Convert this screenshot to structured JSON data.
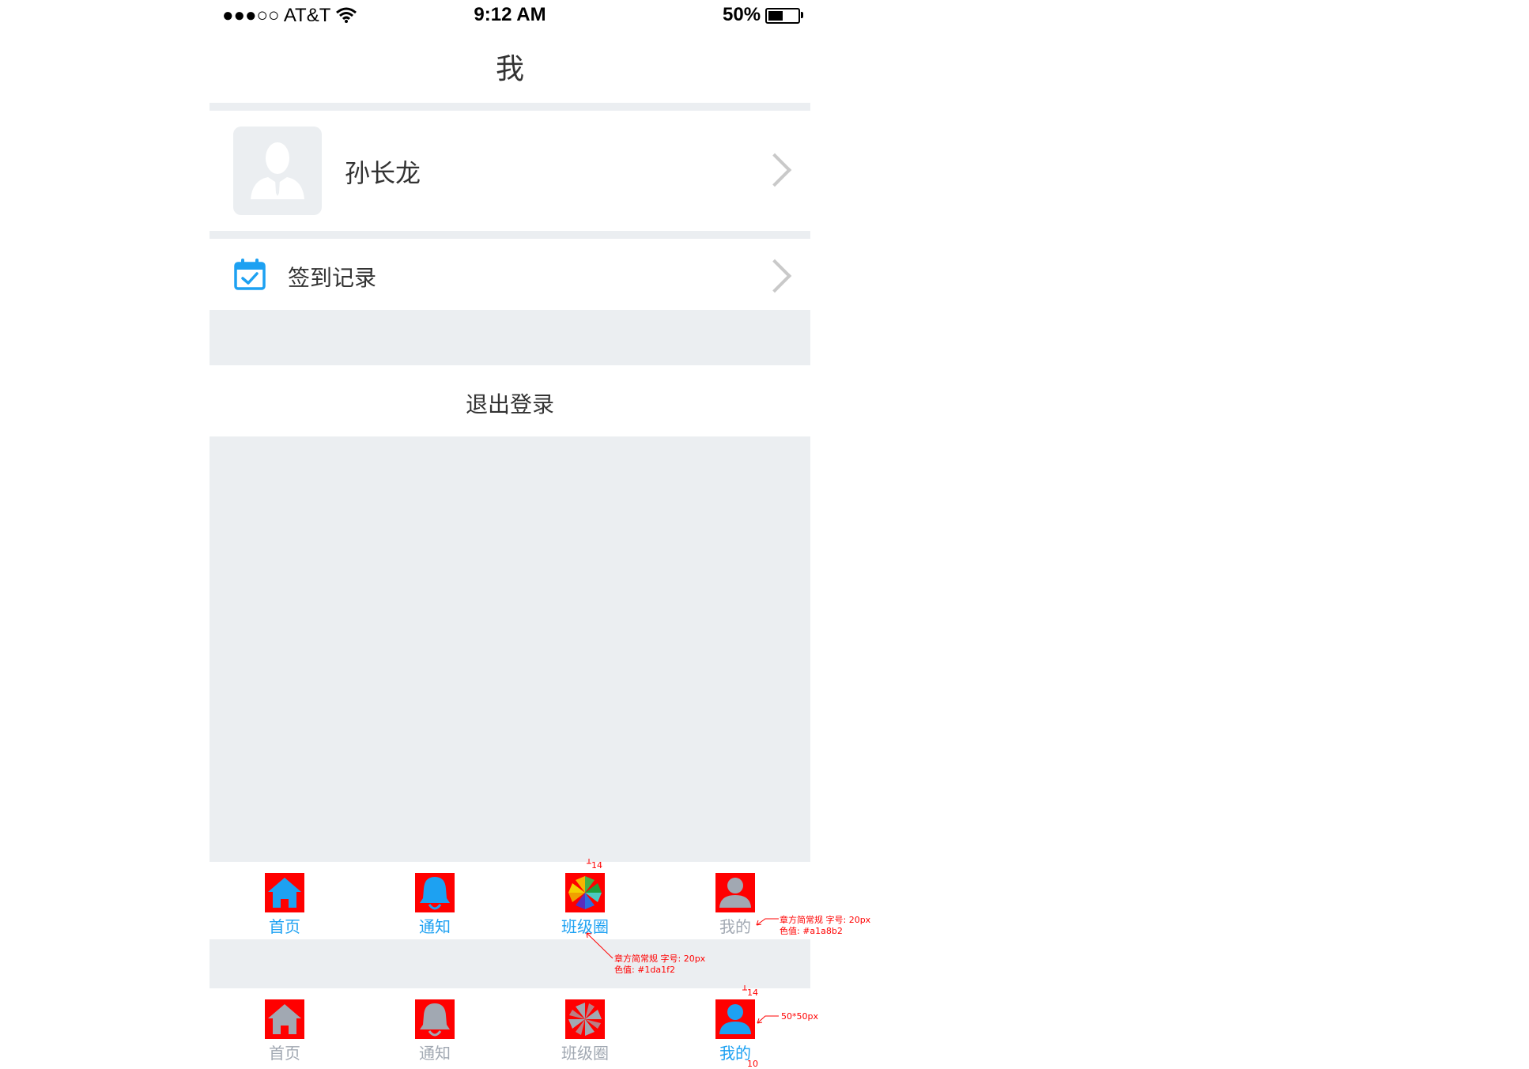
{
  "colors": {
    "active": "#1da1f2",
    "inactive": "#a1a8b2",
    "background": "#ebeef1",
    "annotation": "#ff0000"
  },
  "status_bar": {
    "signal": "●●●○○ AT&T",
    "time": "9:12 AM",
    "battery": "50%",
    "battery_level": 0.5
  },
  "nav": {
    "title": "我"
  },
  "profile": {
    "name": "孙长龙",
    "avatar_icon": "user-silhouette-icon"
  },
  "menu": {
    "sign_in_record": "签到记录"
  },
  "logout": {
    "label": "退出登录"
  },
  "tabbar_1": {
    "selected": "班级圈",
    "tabs": [
      {
        "label": "首页",
        "icon": "home-icon",
        "active": true
      },
      {
        "label": "通知",
        "icon": "bell-icon",
        "active": true
      },
      {
        "label": "班级圈",
        "icon": "pinwheel-icon",
        "active": true
      },
      {
        "label": "我的",
        "icon": "person-icon",
        "active": false
      }
    ]
  },
  "tabbar_2": {
    "selected": "我的",
    "tabs": [
      {
        "label": "首页",
        "icon": "home-icon",
        "active": false
      },
      {
        "label": "通知",
        "icon": "bell-icon",
        "active": false
      },
      {
        "label": "班级圈",
        "icon": "pinwheel-icon",
        "active": false
      },
      {
        "label": "我的",
        "icon": "person-icon",
        "active": true
      }
    ]
  },
  "annotations": {
    "spacing_top_1": "14",
    "spacing_top_2": "14",
    "spacing_bottom": "10",
    "inactive_font": "章方简常规  字号: 20px",
    "inactive_color": "色值: #a1a8b2",
    "active_font": "章方简常规  字号: 20px",
    "active_color": "色值: #1da1f2",
    "icon_size": "50*50px"
  }
}
